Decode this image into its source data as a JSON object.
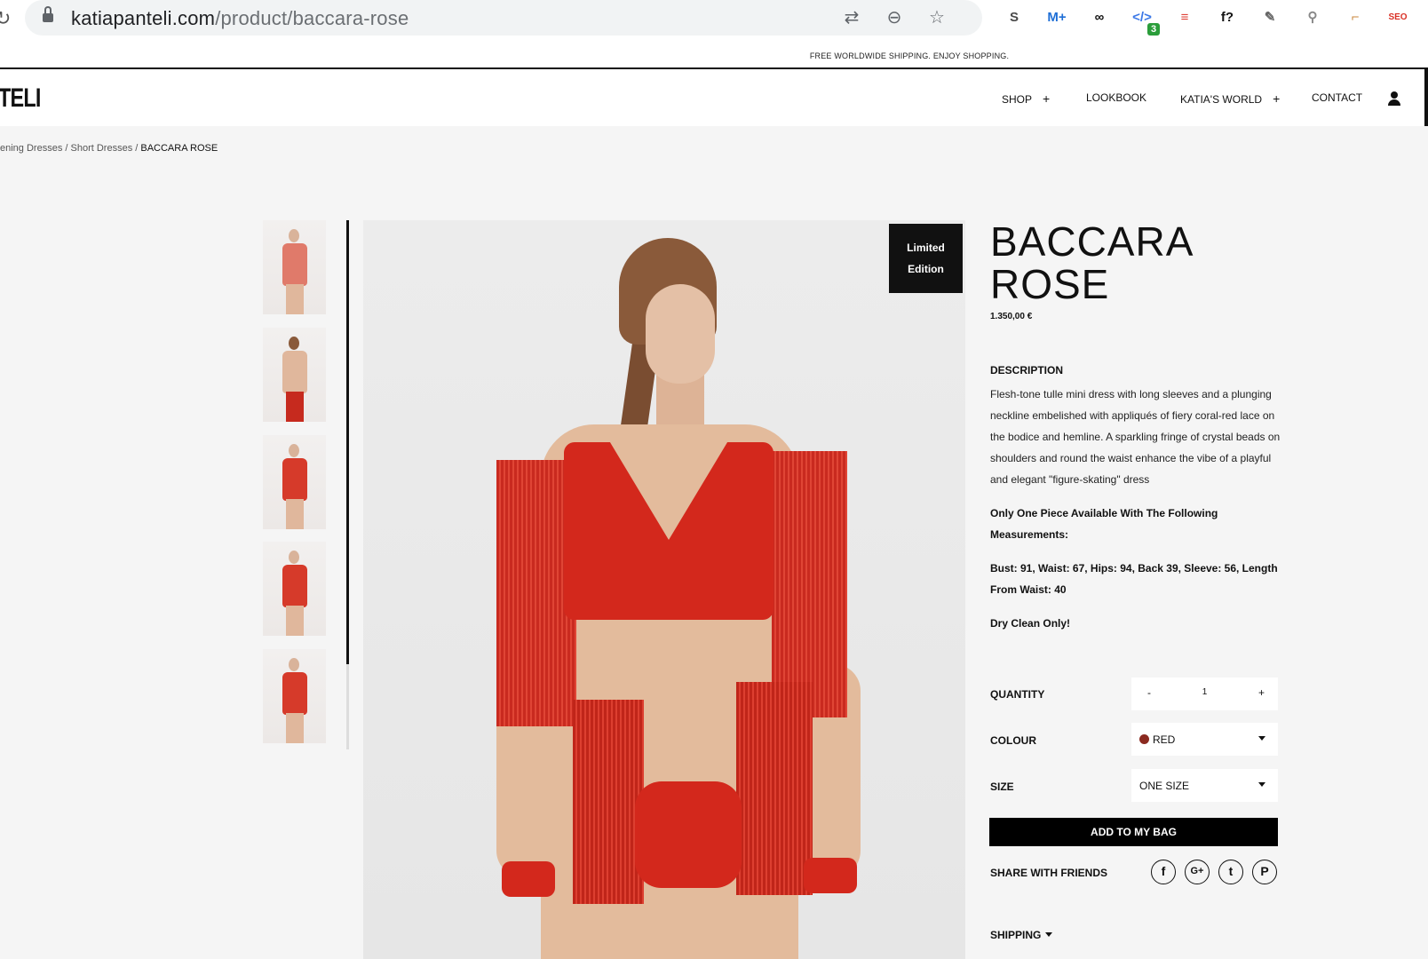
{
  "browser": {
    "url_host": "katiapanteli.com",
    "url_path": "/product/baccara-rose",
    "extensions": [
      {
        "name": "S",
        "icon": "s-extension-icon",
        "color": "#4a4a4a"
      },
      {
        "name": "M+",
        "icon": "movistar-icon",
        "color": "#1f6fd6"
      },
      {
        "name": "∞",
        "icon": "infinity-extension-icon",
        "color": "#111111"
      },
      {
        "name": "</>",
        "icon": "code-extension-icon",
        "color": "#3b78e7",
        "badge": "3"
      },
      {
        "name": "≡",
        "icon": "red-circle-extension-icon",
        "color": "#e0453a"
      },
      {
        "name": "f?",
        "icon": "font-finder-icon",
        "color": "#111111"
      },
      {
        "name": "✎",
        "icon": "eyedropper-icon",
        "color": "#666666"
      },
      {
        "name": "⚲",
        "icon": "magnifier-extension-icon",
        "color": "#888888"
      },
      {
        "name": "⌐",
        "icon": "ruler-extension-icon",
        "color": "#c8863a"
      },
      {
        "name": "SEO",
        "icon": "seo-extension-icon",
        "color": "#d93025"
      }
    ]
  },
  "banner": {
    "text": "FREE WORLDWIDE SHIPPING. ENJOY SHOPPING."
  },
  "header": {
    "logo": "TELI",
    "nav": [
      {
        "label": "SHOP",
        "plus": "+"
      },
      {
        "label": "LOOKBOOK",
        "plus": ""
      },
      {
        "label": "KATIA'S WORLD",
        "plus": "+"
      },
      {
        "label": "CONTACT",
        "plus": ""
      }
    ]
  },
  "breadcrumb": {
    "part1": "ening Dresses",
    "sep": " / ",
    "part2": "Short Dresses",
    "current": "BACCARA ROSE"
  },
  "gallery": {
    "badge_line1": "Limited",
    "badge_line2": "Edition"
  },
  "product": {
    "title_line1": "BACCARA",
    "title_line2": "ROSE",
    "price": "1.350,00 €",
    "description_heading": "DESCRIPTION",
    "description": "Flesh-tone tulle mini dress with long sleeves and a plunging neckline embelished with appliqués of fiery coral-red lace on the bodice and hemline. A sparkling fringe of crystal beads on shoulders and round the waist enhance the vibe of a playful and elegant \"figure-skating\" dress",
    "note_availability": "Only One Piece Available With The Following Measurements:",
    "note_measurements": "Bust: 91, Waist: 67, Hips: 94, Back 39, Sleeve: 56, Length From Waist: 40",
    "note_care": "Dry Clean Only!"
  },
  "options": {
    "quantity_label": "QUANTITY",
    "quantity_minus": "-",
    "quantity_value": "1",
    "quantity_plus": "+",
    "colour_label": "COLOUR",
    "colour_value": "RED",
    "colour_swatch": "#8b2a20",
    "size_label": "SIZE",
    "size_value": "ONE SIZE"
  },
  "actions": {
    "add_to_bag": "ADD TO MY BAG",
    "share_label": "SHARE WITH FRIENDS",
    "share": [
      {
        "icon": "facebook-icon",
        "glyph": "f"
      },
      {
        "icon": "google-plus-icon",
        "glyph": "G+"
      },
      {
        "icon": "twitter-icon",
        "glyph": "t"
      },
      {
        "icon": "pinterest-icon",
        "glyph": "P"
      }
    ],
    "shipping": "SHIPPING"
  }
}
